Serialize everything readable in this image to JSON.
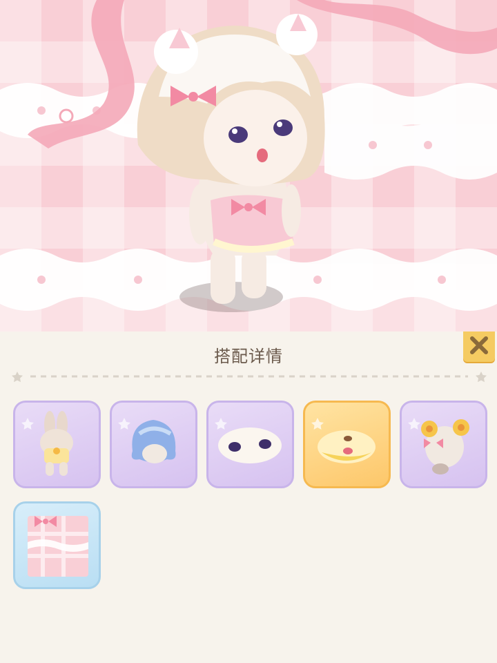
{
  "panel": {
    "title": "搭配详情"
  },
  "items": [
    {
      "name": "bunny-outfit-icon",
      "frame": "purple"
    },
    {
      "name": "blue-hair-icon",
      "frame": "purple"
    },
    {
      "name": "sleepy-eyes-icon",
      "frame": "purple"
    },
    {
      "name": "yellow-mouth-icon",
      "frame": "gold"
    },
    {
      "name": "flower-ears-icon",
      "frame": "purple"
    },
    {
      "name": "pink-plaid-background-icon",
      "frame": "blue"
    }
  ],
  "colors": {
    "accent": "#f5cb62",
    "panel_bg": "#f7f3ec",
    "title_text": "#6b5a4c",
    "scene_pink": "#f9cfd6"
  }
}
